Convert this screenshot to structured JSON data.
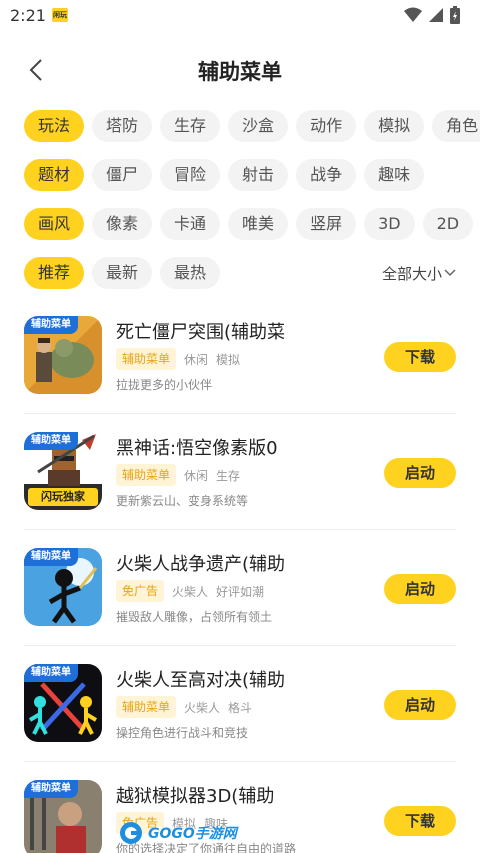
{
  "status_bar": {
    "time": "2:21",
    "app_icon_text": "闲玩"
  },
  "header": {
    "title": "辅助菜单"
  },
  "filters": {
    "gameplay": [
      "玩法",
      "塔防",
      "生存",
      "沙盒",
      "动作",
      "模拟",
      "角色"
    ],
    "theme": [
      "题材",
      "僵尸",
      "冒险",
      "射击",
      "战争",
      "趣味"
    ],
    "style": [
      "画风",
      "像素",
      "卡通",
      "唯美",
      "竖屏",
      "3D",
      "2D"
    ],
    "sort": [
      "推荐",
      "最新",
      "最热"
    ],
    "size_label": "全部大小"
  },
  "games": [
    {
      "badge": "辅助菜单",
      "title": "死亡僵尸突围(辅助菜",
      "tag_hl": "辅助菜单",
      "tags": [
        "休闲",
        "模拟"
      ],
      "desc": "拉拢更多的小伙伴",
      "action": "下载"
    },
    {
      "badge": "辅助菜单",
      "icon_text": "闪玩独家",
      "title": "黑神话:悟空像素版0",
      "tag_hl": "辅助菜单",
      "tags": [
        "休闲",
        "生存"
      ],
      "desc": "更新紫云山、变身系统等",
      "action": "启动"
    },
    {
      "badge": "辅助菜单",
      "title": "火柴人战争遗产(辅助",
      "tag_hl": "免广告",
      "tags": [
        "火柴人",
        "好评如潮"
      ],
      "desc": "摧毁敌人雕像，占领所有领土",
      "action": "启动"
    },
    {
      "badge": "辅助菜单",
      "title": "火柴人至高对决(辅助",
      "tag_hl": "辅助菜单",
      "tags": [
        "火柴人",
        "格斗"
      ],
      "desc": "操控角色进行战斗和竞技",
      "action": "启动"
    },
    {
      "badge": "辅助菜单",
      "title": "越狱模拟器3D(辅助",
      "tag_hl": "免广告",
      "tags": [
        "模拟",
        "趣味"
      ],
      "desc": "你的选择决定了你通往自由的道路",
      "action": "下载"
    }
  ],
  "watermark": {
    "text": "GOGO手游网"
  }
}
